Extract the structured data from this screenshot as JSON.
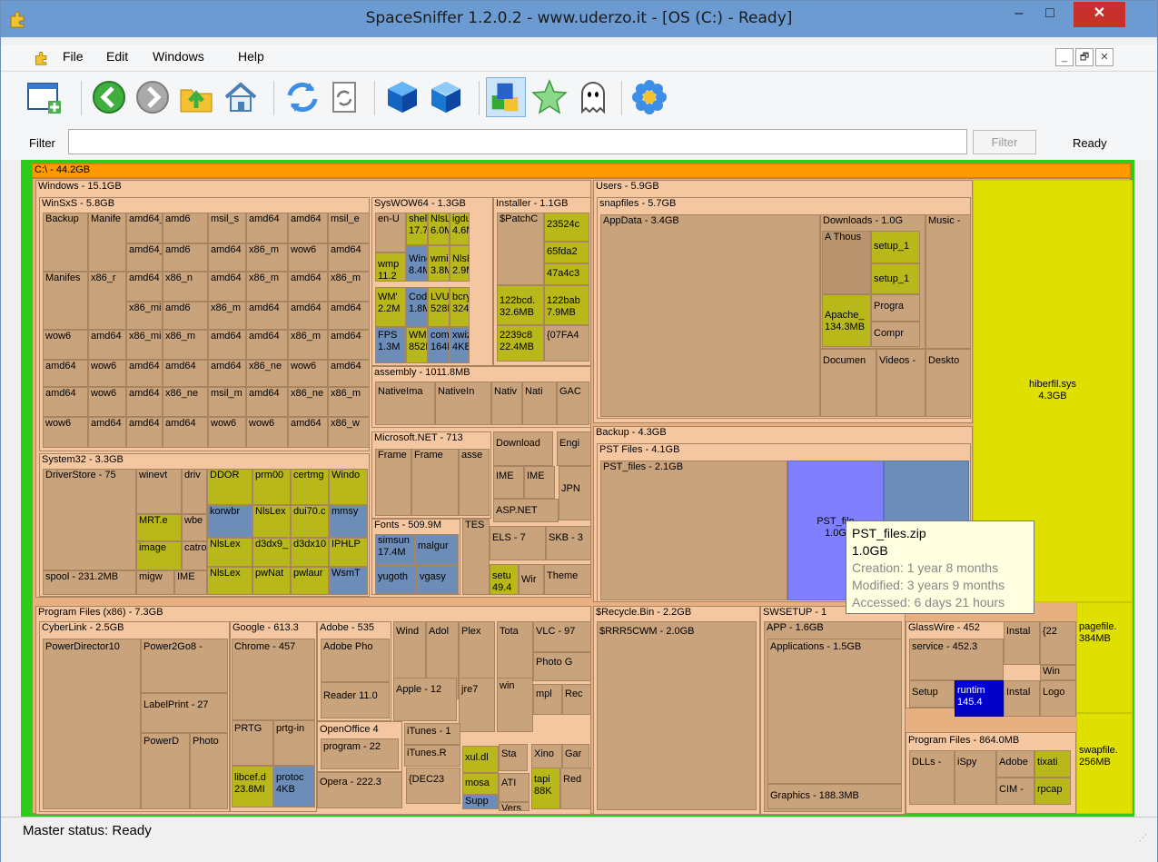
{
  "window": {
    "title": "SpaceSniffer 1.2.0.2 - www.uderzo.it - [OS (C:) - Ready]",
    "minimize_glyph": "–",
    "maximize_glyph": "□",
    "close_glyph": "✕"
  },
  "menu": [
    "File",
    "Edit",
    "Windows",
    "Help"
  ],
  "mdi_buttons": [
    "_",
    "🗗",
    "✕"
  ],
  "toolbar": [
    {
      "icon": "new-window-icon",
      "pressed": false
    },
    {
      "sep": true
    },
    {
      "icon": "back-arrow-icon",
      "pressed": false
    },
    {
      "icon": "forward-arrow-icon",
      "pressed": false
    },
    {
      "icon": "folder-up-icon",
      "pressed": false
    },
    {
      "icon": "home-icon",
      "pressed": false
    },
    {
      "sep": true
    },
    {
      "icon": "refresh-icon",
      "pressed": false
    },
    {
      "icon": "refresh-document-icon",
      "pressed": false
    },
    {
      "sep": true
    },
    {
      "icon": "blue-cube-less-icon",
      "pressed": false
    },
    {
      "icon": "blue-cube-more-icon",
      "pressed": false
    },
    {
      "sep": true
    },
    {
      "icon": "colored-blocks-icon",
      "pressed": true
    },
    {
      "icon": "green-star-icon",
      "pressed": false
    },
    {
      "icon": "ghost-icon",
      "pressed": false
    },
    {
      "sep": true
    },
    {
      "icon": "blue-flower-icon",
      "pressed": false
    }
  ],
  "filter": {
    "label": "Filter",
    "value": "",
    "button": "Filter",
    "status": "Ready"
  },
  "status": "Master status: Ready",
  "tooltip": {
    "name": "PST_files.zip",
    "size": "1.0GB",
    "creation": "Creation: 1 year 8 months",
    "modified": "Modified: 3 years 9 months",
    "accessed": "Accessed: 6 days 21 hours"
  },
  "colors": {
    "dir": "#c8a37c",
    "folder": "#b8956f",
    "header": "#f4c7a0",
    "root": "#ff9900",
    "yellow": "#e0e000",
    "olive": "#b8b81a",
    "steel": "#6b8db8",
    "periwinkle": "#8080ff",
    "navy": "#0000c8",
    "progress": "#2ecc1a"
  },
  "treemap": {
    "root": "C:\\ - 44.2GB",
    "windows": "Windows - 15.1GB",
    "winsxs": "WinSxS - 5.8GB",
    "winsxs_cells": [
      [
        "Backup",
        "Manife",
        "amd64_",
        "amd6",
        "msil_s",
        "amd64",
        "amd64",
        "msil_e"
      ],
      [
        "",
        "",
        "amd64_",
        "amd6",
        "amd64",
        "x86_m",
        "wow6",
        "amd64"
      ],
      [
        "Manifes",
        "x86_r",
        "amd64",
        "x86_n",
        "amd64",
        "x86_m",
        "amd64",
        "x86_m"
      ],
      [
        "",
        "",
        "x86_mi",
        "amd6",
        "x86_m",
        "amd64",
        "amd64",
        "amd64"
      ],
      [
        "wow6",
        "amd64",
        "x86_mi",
        "x86_m",
        "amd64",
        "amd64",
        "x86_m",
        "amd64"
      ],
      [
        "amd64",
        "wow6",
        "amd64",
        "amd64",
        "amd64",
        "x86_ne",
        "wow6",
        "amd64"
      ],
      [
        "amd64",
        "wow6",
        "amd64",
        "x86_ne",
        "msil_m",
        "amd64",
        "x86_ne",
        "x86_m"
      ],
      [
        "wow6",
        "amd64",
        "amd64",
        "amd64",
        "wow6",
        "wow6",
        "amd64",
        "x86_w"
      ]
    ],
    "system32": "System32 - 3.3GB",
    "system32_cells": [
      "DriverStore - 75",
      "winevt",
      "driv",
      "DDOR",
      "prm00",
      "certmg",
      "Windo",
      "MRT.e",
      "wbe",
      "korwbr",
      "NlsLex",
      "dui70.c",
      "mmsy",
      "image",
      "catro",
      "NlsLex",
      "d3dx9_",
      "d3dx10",
      "IPHLP",
      "spool - 231.2MB",
      "migw",
      "IME",
      "NlsLex",
      "pwNat",
      "pwlaur",
      "WsmT"
    ],
    "syswow64": "SysWOW64 - 1.3GB",
    "syswow_cells": [
      "en-U",
      "shel",
      "NlsL",
      "igdu",
      "17.7",
      "6.0M",
      "4.6M",
      "wmp",
      "Winc",
      "wmi",
      "NlsL",
      "11.2",
      "8.4M",
      "3.8M",
      "2.9M",
      "WM'",
      "Code",
      "LVU",
      "bcry",
      "2.2M",
      "1.8M",
      "528K",
      "324K",
      "FPS",
      "WM!",
      "com",
      "xwiz",
      "1.3M",
      "852K",
      "164K",
      "4KB"
    ],
    "installer": "Installer - 1.1GB",
    "installer_cells": [
      "$PatchC",
      "23524c",
      "65fda2",
      "47a4c3",
      "122bcd.",
      "32.6MB",
      "122bab",
      "7.9MB",
      "2239c8",
      "22.4MB",
      "{07FA4"
    ],
    "assembly": "assembly - 1011.8MB",
    "assembly_cells": [
      "NativeIma",
      "NativeIn",
      "Nativ",
      "Nati",
      "GAC"
    ],
    "dotnet": "Microsoft.NET - 713",
    "dotnet_cells": [
      "Frame",
      "Frame",
      "asse"
    ],
    "download": "Download",
    "engi": "Engi",
    "ime": [
      "IME",
      "IME"
    ],
    "jpn": "JPN",
    "aspnet": "ASP.NET",
    "fonts": "Fonts - 509.9M",
    "fonts_cells": [
      "simsun",
      "17.4M",
      "malgur",
      "yugoth",
      "vgasy"
    ],
    "tes": "TES",
    "els": "ELS - 7",
    "skb": "SKB - 3",
    "setu": [
      "setu",
      "49.4"
    ],
    "wir": "Wir",
    "theme": "Theme",
    "users": "Users - 5.9GB",
    "snapfiles": "snapfiles - 5.7GB",
    "appdata": "AppData - 3.4GB",
    "downloads": "Downloads - 1.0G",
    "downloads_cells": [
      "A Thous",
      "setup_1",
      "setup_1",
      "Apache_",
      "134.3MB",
      "Progra",
      "Compr"
    ],
    "music": "Music -",
    "documents": "Documen",
    "videos": "Videos -",
    "desktop": "Deskto",
    "hiberfil": "hiberfil.sys",
    "hiberfil_size": "4.3GB",
    "backup": "Backup - 4.3GB",
    "pst": "PST Files - 4.1GB",
    "pst_files": "PST_files - 2.1GB",
    "pst_zip": "PST_file",
    "pst_zip_size": "1.0G",
    "pagefile": "pagefile.",
    "pagefile_size": "384MB",
    "swapfile": "swapfile.",
    "swapfile_size": "256MB",
    "pfx86": "Program Files (x86) - 7.3GB",
    "cyberlink": "CyberLink - 2.5GB",
    "cyberlink_cells": [
      "PowerDirector10",
      "Power2Go8 -",
      "LabelPrint - 27",
      "PowerD",
      "Photo"
    ],
    "google": "Google - 613.3",
    "chrome": "Chrome - 457",
    "prtg": [
      "PRTG",
      "prtg-in"
    ],
    "libcef": [
      "libcef.d",
      "23.8MI"
    ],
    "protoc": [
      "protoc",
      "4KB"
    ],
    "adobe": "Adobe - 535",
    "adobe_cells": [
      "Adobe Pho",
      "Reader 11.0"
    ],
    "openoffice": "OpenOffice 4",
    "oo_program": "program - 22",
    "opera": "Opera - 222.3",
    "pf_misc": [
      "Wind",
      "Adol",
      "Plex",
      "Tota",
      "VLC - 97",
      "Photo G",
      "Apple - 12",
      "jre7",
      "win",
      "mpl",
      "Rec",
      "iTunes - 1",
      "iTunes.R",
      "xul.dl",
      "Sta",
      "Xino",
      "Gar",
      "{DEC23",
      "mosa",
      "ATI",
      "Supp",
      "Vers",
      "tapi",
      "88K",
      "Red"
    ],
    "recycle": "$Recycle.Bin - 2.2GB",
    "rrr": "$RRR5CWM - 2.0GB",
    "swsetup": "SWSETUP - 1",
    "app": "APP - 1.6GB",
    "applications": "Applications - 1.5GB",
    "graphics": "Graphics - 188.3MB",
    "glasswire": "GlassWire - 452",
    "service": "service - 452.3",
    "setup": "Setup",
    "runtim": [
      "runtim",
      "145.4"
    ],
    "instal": [
      "Instal",
      "Instal"
    ],
    "logo": "Logo",
    "wir2": "Win",
    "brace": "{22",
    "pf": "Program Files - 864.0MB",
    "pf_cells": [
      "DLLs -",
      "iSpy",
      "Adobe",
      "tixati",
      "CIM -",
      "rpcap"
    ]
  }
}
